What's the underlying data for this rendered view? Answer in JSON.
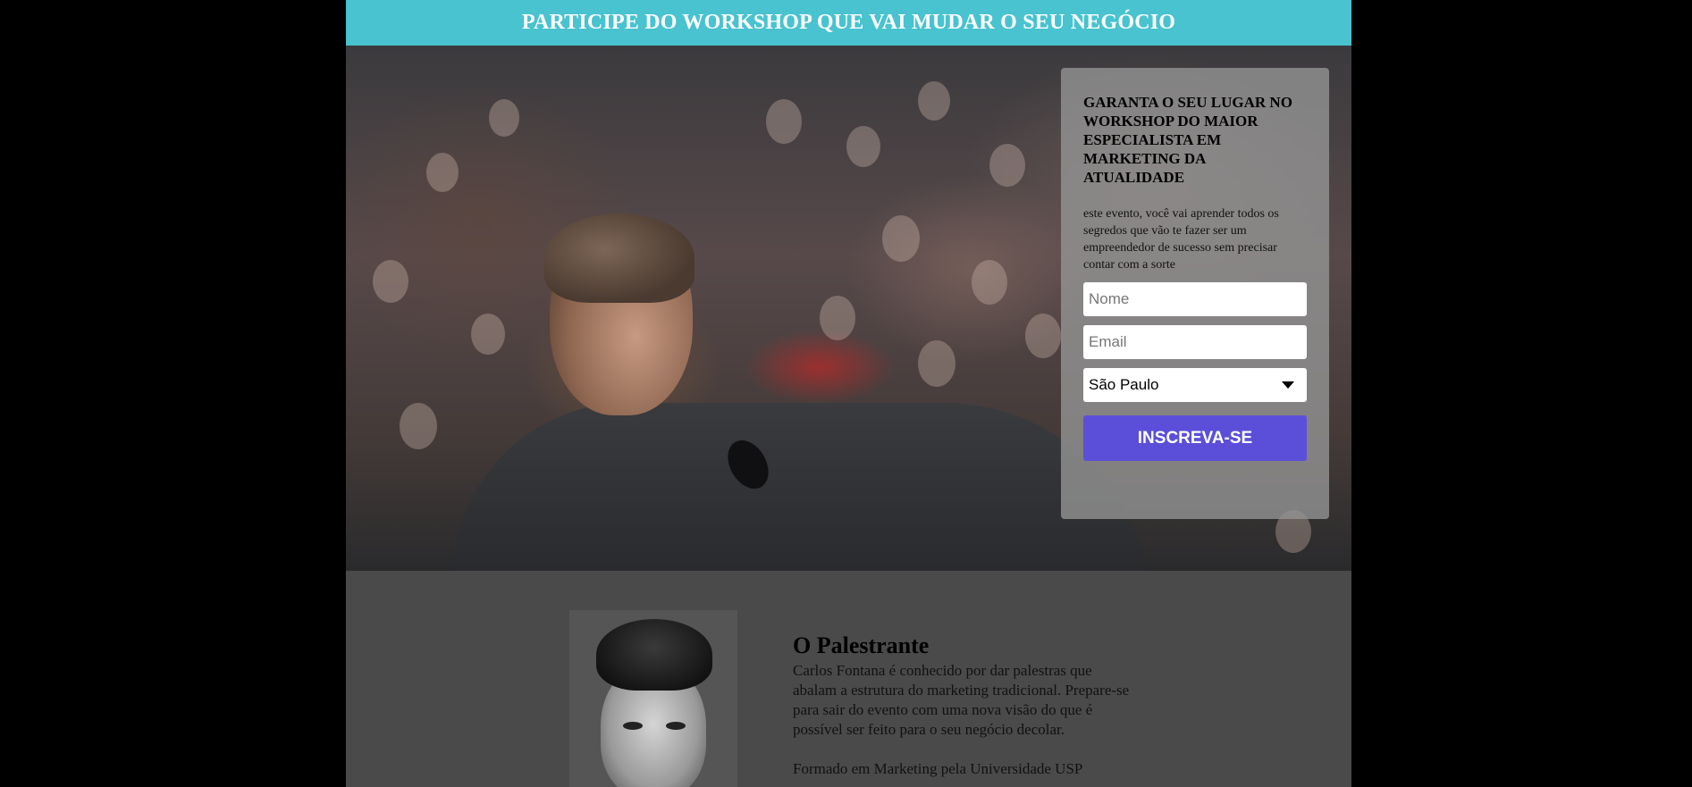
{
  "header": {
    "title": "PARTICIPE DO WORKSHOP QUE VAI MUDAR O SEU NEGÓCIO"
  },
  "form": {
    "title": "GARANTA O SEU LUGAR NO WORKSHOP DO MAIOR ESPECIALISTA EM MARKETING DA ATUALIDADE",
    "description": "este evento, você vai aprender todos os segredos que vão te fazer ser um empreendedor de sucesso sem precisar contar com a sorte",
    "name_placeholder": "Nome",
    "email_placeholder": "Email",
    "city_selected": "São Paulo",
    "submit_label": "INSCREVA-SE"
  },
  "speaker": {
    "heading": "O Palestrante",
    "bio": "Carlos Fontana é conhecido por dar palestras que abalam a estrutura do marketing tradicional. Prepare-se para sair do evento com uma nova visão do que é possível ser feito para o seu negócio decolar.",
    "bio_2": "Formado em Marketing pela Universidade USP"
  },
  "colors": {
    "topbar": "#48c3cf",
    "button": "#5b4fd9",
    "section_bg": "#4a4a4a"
  }
}
